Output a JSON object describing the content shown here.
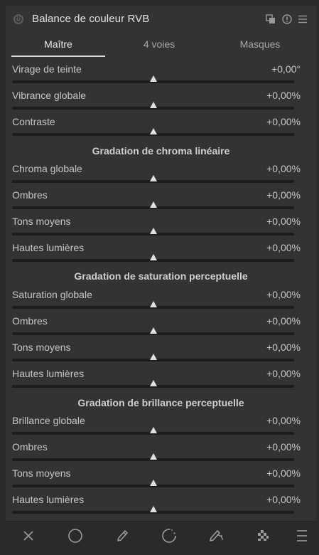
{
  "module": {
    "title": "Balance de couleur RVB",
    "icons": [
      "power-icon",
      "multi-instance-icon",
      "reset-icon",
      "presets-menu-icon"
    ]
  },
  "tabs": [
    {
      "label": "Maître",
      "active": true
    },
    {
      "label": "4 voies",
      "active": false
    },
    {
      "label": "Masques",
      "active": false
    }
  ],
  "general": {
    "hue_shift": {
      "label": "Virage de teinte",
      "value": "+0,00°"
    },
    "global_vibrance": {
      "label": "Vibrance globale",
      "value": "+0,00%"
    },
    "contrast": {
      "label": "Contraste",
      "value": "+0,00%"
    }
  },
  "chroma": {
    "title": "Gradation de chroma linéaire",
    "rows": [
      {
        "label": "Chroma globale",
        "value": "+0,00%"
      },
      {
        "label": "Ombres",
        "value": "+0,00%"
      },
      {
        "label": "Tons moyens",
        "value": "+0,00%"
      },
      {
        "label": "Hautes lumières",
        "value": "+0,00%"
      }
    ]
  },
  "saturation": {
    "title": "Gradation de saturation perceptuelle",
    "rows": [
      {
        "label": "Saturation globale",
        "value": "+0,00%"
      },
      {
        "label": "Ombres",
        "value": "+0,00%"
      },
      {
        "label": "Tons moyens",
        "value": "+0,00%"
      },
      {
        "label": "Hautes lumières",
        "value": "+0,00%"
      }
    ]
  },
  "brilliance": {
    "title": "Gradation de brillance perceptuelle",
    "rows": [
      {
        "label": "Brillance globale",
        "value": "+0,00%"
      },
      {
        "label": "Ombres",
        "value": "+0,00%"
      },
      {
        "label": "Tons moyens",
        "value": "+0,00%"
      },
      {
        "label": "Hautes lumières",
        "value": "+0,00%"
      }
    ]
  },
  "slider_position": 0.5,
  "footer": {
    "buttons": [
      "mask-off-icon",
      "uniform-mask-icon",
      "drawn-mask-icon",
      "parametric-mask-icon",
      "drawn-parametric-mask-icon",
      "raster-mask-icon",
      "blend-options-icon"
    ]
  },
  "colors": {
    "panel_bg": "#333333",
    "track": "#1d1d1d",
    "text": "#c6c6c6",
    "title": "#e2e2e2"
  }
}
